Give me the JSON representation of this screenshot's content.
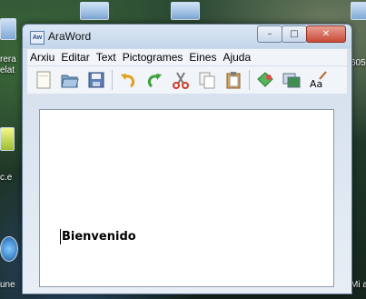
{
  "window": {
    "title": "AraWord",
    "app_icon_text": "Aw"
  },
  "menu": [
    "Arxiu",
    "Editar",
    "Text",
    "Pictogrames",
    "Eines",
    "Ajuda"
  ],
  "toolbar": [
    "new-document-icon",
    "open-folder-icon",
    "save-icon",
    "undo-icon",
    "redo-icon",
    "cut-icon",
    "copy-icon",
    "paste-icon",
    "pictogram-icon",
    "window-icon",
    "font-icon"
  ],
  "document": {
    "text": "Bienvenido"
  },
  "desktop": {
    "labels": [
      "rera",
      "elat",
      "c.e",
      "une",
      "605",
      "Mi a"
    ]
  }
}
